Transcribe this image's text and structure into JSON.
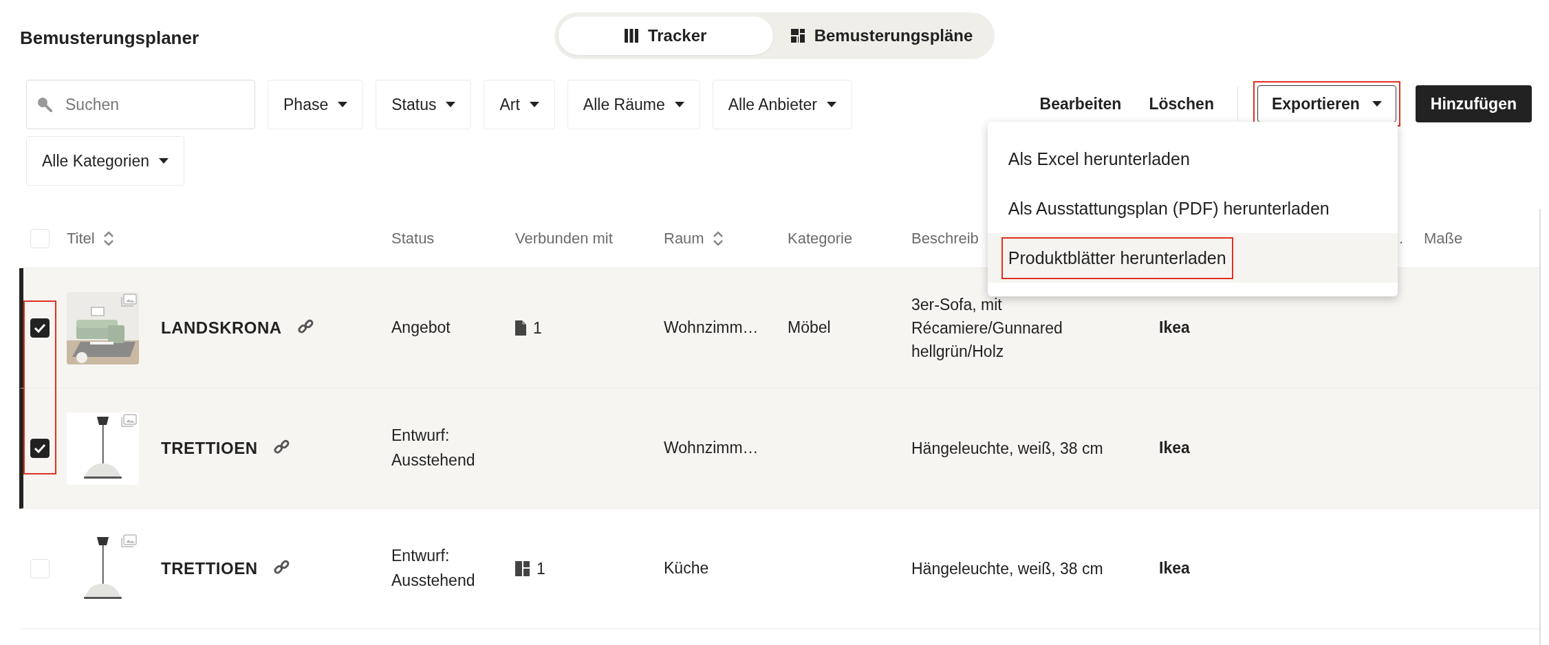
{
  "header": {
    "title": "Bemusterungsplaner",
    "view_tabs": [
      {
        "label": "Tracker",
        "kind": "tracker",
        "selected": true
      },
      {
        "label": "Bemusterungspläne",
        "kind": "plans",
        "selected": false
      }
    ]
  },
  "toolbar": {
    "search": {
      "placeholder": "Suchen"
    },
    "filters": [
      {
        "label": "Phase"
      },
      {
        "label": "Status"
      },
      {
        "label": "Art"
      },
      {
        "label": "Alle Räume"
      },
      {
        "label": "Alle Anbieter"
      },
      {
        "label": "Alle Kategorien"
      }
    ],
    "actions": [
      {
        "label": "Bearbeiten"
      },
      {
        "label": "Löschen"
      }
    ],
    "export_button": {
      "label": "Exportieren",
      "expanded": true,
      "highlighted": true
    },
    "add_button": {
      "label": "Hinzufügen"
    },
    "export_menu": [
      {
        "label": "Als Excel herunterladen",
        "hovered": false,
        "highlighted": false
      },
      {
        "label": "Als Ausstattungsplan (PDF) herunterladen",
        "hovered": false,
        "highlighted": false
      },
      {
        "label": "Produktblätter herunterladen",
        "hovered": true,
        "highlighted": true
      }
    ]
  },
  "table": {
    "select_all": {
      "checked": false
    },
    "checkbox_highlighted": true,
    "columns": [
      {
        "label": "Titel",
        "kind": "text",
        "sortable": true
      },
      {
        "label": "Status",
        "kind": "text",
        "sortable": false
      },
      {
        "label": "Verbunden mit",
        "kind": "text",
        "sortable": false
      },
      {
        "label": "Raum",
        "kind": "text",
        "sortable": true
      },
      {
        "label": "Kategorie",
        "kind": "text",
        "sortable": false
      },
      {
        "label": "Beschreib",
        "kind": "text"
      },
      {
        "label": ".",
        "kind": "clipped"
      },
      {
        "label": "Maße",
        "kind": "text",
        "sortable": false
      }
    ],
    "rows": [
      {
        "checked": true,
        "title": "LANDSKRONA",
        "status": "Angebot",
        "linked": {
          "kind": "document",
          "count": "1"
        },
        "room": "Wohnzimm…",
        "category": "Möbel",
        "description": "3er-Sofa, mit Récamiere/Gunnared hellgrün/Holz",
        "vendor": "Ikea"
      },
      {
        "checked": true,
        "title": "TRETTIOEN",
        "status": "Entwurf: Ausstehend",
        "room": "Wohnzimm…",
        "description": "Hängeleuchte, weiß, 38 cm",
        "vendor": "Ikea"
      },
      {
        "checked": false,
        "title": "TRETTIOEN",
        "status": "Entwurf: Ausstehend",
        "linked": {
          "kind": "plan",
          "count": "1"
        },
        "room": "Küche",
        "description": "Hängeleuchte, weiß, 38 cm",
        "vendor": "Ikea"
      }
    ]
  }
}
